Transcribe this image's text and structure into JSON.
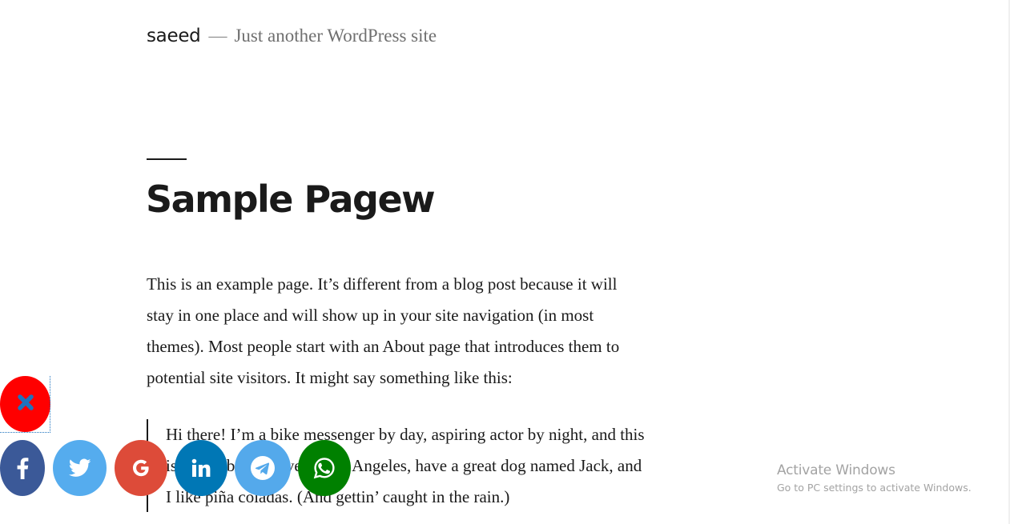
{
  "site": {
    "title": "saeed",
    "separator": "—",
    "description": "Just another WordPress site"
  },
  "page": {
    "title": "Sample Pagew",
    "intro": "This is an example page. It’s different from a blog post because it will stay in one place and will show up in your site navigation (in most themes). Most people start with an About page that introduces them to potential site visitors. It might say something like this:",
    "quote": "Hi there! I’m a bike messenger by day, aspiring actor by night, and this is my website. I live in Los Angeles, have a great dog named Jack, and I like piña coladas. (And gettin’ caught in the rain.)"
  },
  "share_bar": {
    "close_icon": "close-icon",
    "buttons": [
      {
        "name": "facebook",
        "icon": "facebook-icon",
        "color": "#3b5998"
      },
      {
        "name": "twitter",
        "icon": "twitter-icon",
        "color": "#55acee"
      },
      {
        "name": "google",
        "icon": "google-icon",
        "color": "#dd4b39"
      },
      {
        "name": "linkedin",
        "icon": "linkedin-icon",
        "color": "#0077b5"
      },
      {
        "name": "telegram",
        "icon": "telegram-icon",
        "color": "#54a9eb"
      },
      {
        "name": "whatsapp",
        "icon": "whatsapp-icon",
        "color": "#008000"
      }
    ],
    "close_color": "#ff0000"
  },
  "watermark": {
    "title": "Activate Windows",
    "subtitle": "Go to PC settings to activate Windows."
  }
}
